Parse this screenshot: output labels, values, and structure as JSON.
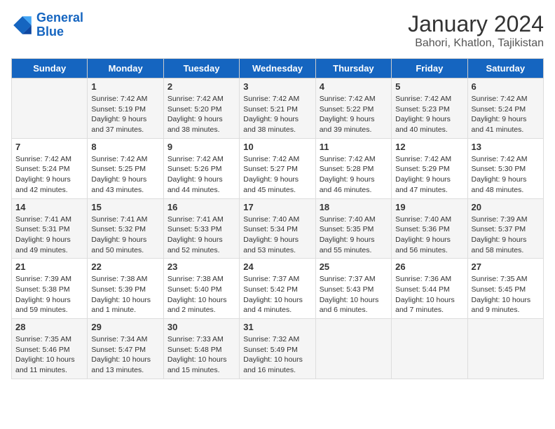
{
  "header": {
    "logo_general": "General",
    "logo_blue": "Blue",
    "main_title": "January 2024",
    "subtitle": "Bahori, Khatlon, Tajikistan"
  },
  "calendar": {
    "weekdays": [
      "Sunday",
      "Monday",
      "Tuesday",
      "Wednesday",
      "Thursday",
      "Friday",
      "Saturday"
    ],
    "weeks": [
      [
        {
          "day": "",
          "info": ""
        },
        {
          "day": "1",
          "info": "Sunrise: 7:42 AM\nSunset: 5:19 PM\nDaylight: 9 hours\nand 37 minutes."
        },
        {
          "day": "2",
          "info": "Sunrise: 7:42 AM\nSunset: 5:20 PM\nDaylight: 9 hours\nand 38 minutes."
        },
        {
          "day": "3",
          "info": "Sunrise: 7:42 AM\nSunset: 5:21 PM\nDaylight: 9 hours\nand 38 minutes."
        },
        {
          "day": "4",
          "info": "Sunrise: 7:42 AM\nSunset: 5:22 PM\nDaylight: 9 hours\nand 39 minutes."
        },
        {
          "day": "5",
          "info": "Sunrise: 7:42 AM\nSunset: 5:23 PM\nDaylight: 9 hours\nand 40 minutes."
        },
        {
          "day": "6",
          "info": "Sunrise: 7:42 AM\nSunset: 5:24 PM\nDaylight: 9 hours\nand 41 minutes."
        }
      ],
      [
        {
          "day": "7",
          "info": "Sunrise: 7:42 AM\nSunset: 5:24 PM\nDaylight: 9 hours\nand 42 minutes."
        },
        {
          "day": "8",
          "info": "Sunrise: 7:42 AM\nSunset: 5:25 PM\nDaylight: 9 hours\nand 43 minutes."
        },
        {
          "day": "9",
          "info": "Sunrise: 7:42 AM\nSunset: 5:26 PM\nDaylight: 9 hours\nand 44 minutes."
        },
        {
          "day": "10",
          "info": "Sunrise: 7:42 AM\nSunset: 5:27 PM\nDaylight: 9 hours\nand 45 minutes."
        },
        {
          "day": "11",
          "info": "Sunrise: 7:42 AM\nSunset: 5:28 PM\nDaylight: 9 hours\nand 46 minutes."
        },
        {
          "day": "12",
          "info": "Sunrise: 7:42 AM\nSunset: 5:29 PM\nDaylight: 9 hours\nand 47 minutes."
        },
        {
          "day": "13",
          "info": "Sunrise: 7:42 AM\nSunset: 5:30 PM\nDaylight: 9 hours\nand 48 minutes."
        }
      ],
      [
        {
          "day": "14",
          "info": "Sunrise: 7:41 AM\nSunset: 5:31 PM\nDaylight: 9 hours\nand 49 minutes."
        },
        {
          "day": "15",
          "info": "Sunrise: 7:41 AM\nSunset: 5:32 PM\nDaylight: 9 hours\nand 50 minutes."
        },
        {
          "day": "16",
          "info": "Sunrise: 7:41 AM\nSunset: 5:33 PM\nDaylight: 9 hours\nand 52 minutes."
        },
        {
          "day": "17",
          "info": "Sunrise: 7:40 AM\nSunset: 5:34 PM\nDaylight: 9 hours\nand 53 minutes."
        },
        {
          "day": "18",
          "info": "Sunrise: 7:40 AM\nSunset: 5:35 PM\nDaylight: 9 hours\nand 55 minutes."
        },
        {
          "day": "19",
          "info": "Sunrise: 7:40 AM\nSunset: 5:36 PM\nDaylight: 9 hours\nand 56 minutes."
        },
        {
          "day": "20",
          "info": "Sunrise: 7:39 AM\nSunset: 5:37 PM\nDaylight: 9 hours\nand 58 minutes."
        }
      ],
      [
        {
          "day": "21",
          "info": "Sunrise: 7:39 AM\nSunset: 5:38 PM\nDaylight: 9 hours\nand 59 minutes."
        },
        {
          "day": "22",
          "info": "Sunrise: 7:38 AM\nSunset: 5:39 PM\nDaylight: 10 hours\nand 1 minute."
        },
        {
          "day": "23",
          "info": "Sunrise: 7:38 AM\nSunset: 5:40 PM\nDaylight: 10 hours\nand 2 minutes."
        },
        {
          "day": "24",
          "info": "Sunrise: 7:37 AM\nSunset: 5:42 PM\nDaylight: 10 hours\nand 4 minutes."
        },
        {
          "day": "25",
          "info": "Sunrise: 7:37 AM\nSunset: 5:43 PM\nDaylight: 10 hours\nand 6 minutes."
        },
        {
          "day": "26",
          "info": "Sunrise: 7:36 AM\nSunset: 5:44 PM\nDaylight: 10 hours\nand 7 minutes."
        },
        {
          "day": "27",
          "info": "Sunrise: 7:35 AM\nSunset: 5:45 PM\nDaylight: 10 hours\nand 9 minutes."
        }
      ],
      [
        {
          "day": "28",
          "info": "Sunrise: 7:35 AM\nSunset: 5:46 PM\nDaylight: 10 hours\nand 11 minutes."
        },
        {
          "day": "29",
          "info": "Sunrise: 7:34 AM\nSunset: 5:47 PM\nDaylight: 10 hours\nand 13 minutes."
        },
        {
          "day": "30",
          "info": "Sunrise: 7:33 AM\nSunset: 5:48 PM\nDaylight: 10 hours\nand 15 minutes."
        },
        {
          "day": "31",
          "info": "Sunrise: 7:32 AM\nSunset: 5:49 PM\nDaylight: 10 hours\nand 16 minutes."
        },
        {
          "day": "",
          "info": ""
        },
        {
          "day": "",
          "info": ""
        },
        {
          "day": "",
          "info": ""
        }
      ]
    ]
  }
}
